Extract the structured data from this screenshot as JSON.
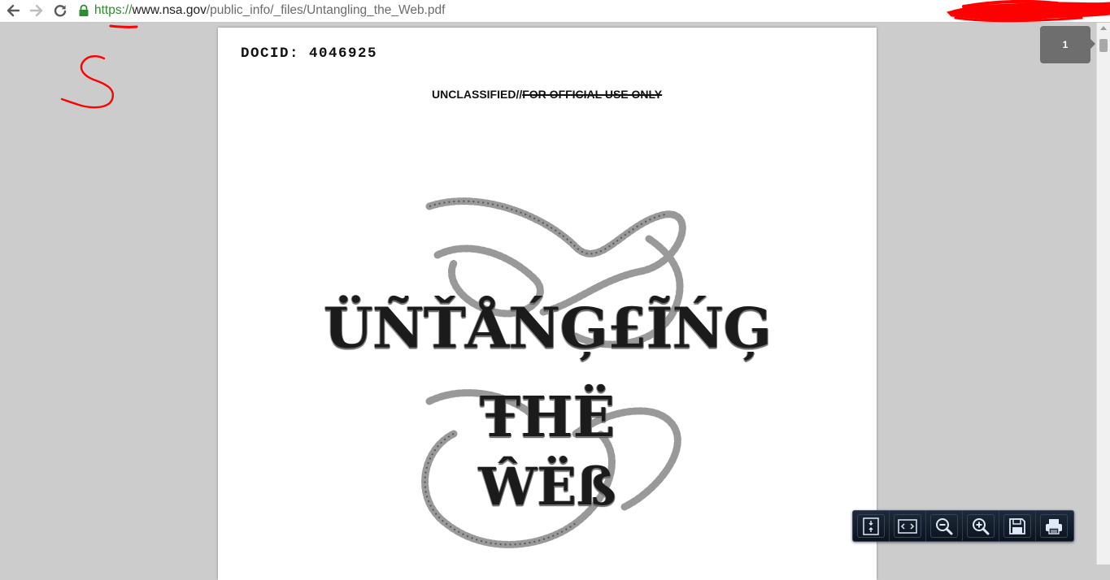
{
  "browser": {
    "url_scheme": "https://",
    "url_host": "www.nsa.gov",
    "url_path": "/public_info/_files/Untangling_the_Web.pdf",
    "icons": [
      "back-arrow-icon",
      "forward-arrow-icon",
      "reload-icon",
      "lock-icon"
    ]
  },
  "annotation": {
    "handwritten_letter": "S",
    "color": "#ff0000"
  },
  "document": {
    "docid": "DOCID: 4046925",
    "classification_plain": "UNCLASSIFIED//",
    "classification_struck": "FOR OFFICIAL USE ONLY",
    "cover_line_1": "ÜÑŤÅŃĢ£ĨŃĢ",
    "cover_line_2": "ŦHË",
    "cover_line_3": "ŴËß"
  },
  "viewer": {
    "page_number": "1",
    "controls": [
      {
        "name": "fit-page-icon"
      },
      {
        "name": "fit-width-icon"
      },
      {
        "name": "zoom-out-icon"
      },
      {
        "name": "zoom-in-icon"
      },
      {
        "name": "save-icon"
      },
      {
        "name": "print-icon"
      }
    ]
  }
}
